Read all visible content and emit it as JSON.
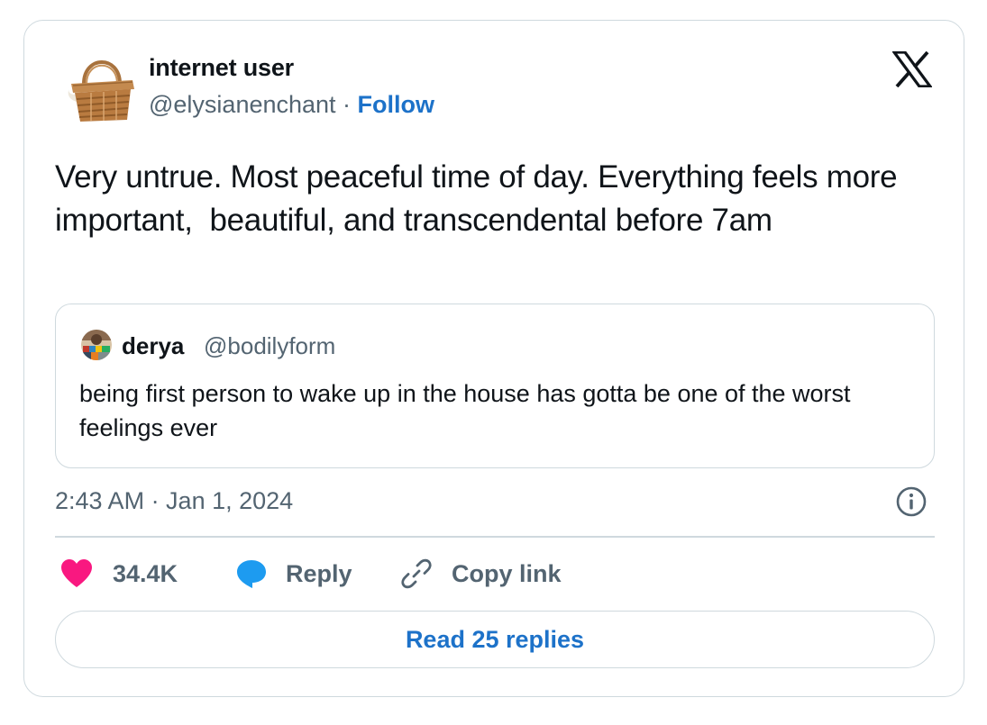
{
  "author": {
    "name": "internet user",
    "handle": "@elysianenchant",
    "separator": " · ",
    "follow_label": "Follow"
  },
  "tweet": {
    "text": "Very untrue. Most peaceful time of day. Everything feels more important,  beautiful, and transcendental before 7am",
    "timestamp": "2:43 AM · Jan 1, 2024"
  },
  "quoted_tweet": {
    "name": "derya",
    "handle": "@bodilyform",
    "text": "being first person to wake up in the house has gotta be one of the worst feelings ever"
  },
  "actions": {
    "like_count": "34.4K",
    "reply_label": "Reply",
    "copy_label": "Copy link"
  },
  "read_replies_label": "Read 25 replies",
  "icons": {
    "logo": "x-logo-icon",
    "info": "info-icon",
    "like": "heart-icon",
    "reply": "speech-bubble-icon",
    "copy": "link-icon"
  },
  "colors": {
    "link_blue": "#1d72c9",
    "heart_pink": "#f91880",
    "reply_blue": "#1d9bf0",
    "muted": "#536471",
    "border": "#cfd9de"
  }
}
